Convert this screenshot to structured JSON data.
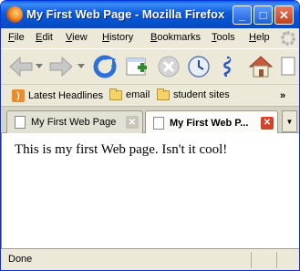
{
  "window": {
    "title": "My First Web Page - Mozilla Firefox",
    "minimize_glyph": "_",
    "maximize_glyph": "□",
    "close_glyph": "✕"
  },
  "menu": {
    "items": [
      {
        "first": "F",
        "rest": "ile"
      },
      {
        "first": "E",
        "rest": "dit"
      },
      {
        "first": "V",
        "rest": "iew"
      },
      {
        "first": "H",
        "rest": "istory"
      },
      {
        "first": "B",
        "rest": "ookmarks"
      },
      {
        "first": "T",
        "rest": "ools"
      },
      {
        "first": "H",
        "rest": "elp"
      }
    ]
  },
  "navbar": {
    "icons": [
      "back-icon",
      "back-dropdown-icon",
      "forward-icon",
      "forward-dropdown-icon",
      "reload-icon",
      "new-tab-icon",
      "stop-icon",
      "history-clock-icon",
      "addon-seahorse-icon",
      "home-icon"
    ],
    "accent": "#2f8a2f"
  },
  "bookmarks": {
    "items": [
      {
        "label": "Latest Headlines",
        "icon": "rss-icon"
      },
      {
        "label": "email",
        "icon": "folder-icon"
      },
      {
        "label": "student sites",
        "icon": "folder-icon"
      }
    ],
    "overflow_glyph": "»"
  },
  "tabs": {
    "items": [
      {
        "label": "My First Web Page",
        "active": false,
        "close_glyph": "✕"
      },
      {
        "label": "My First Web P...",
        "active": true,
        "close_glyph": "✕"
      }
    ],
    "list_glyph": "▼"
  },
  "content": {
    "text": "This is my first Web page. Isn't it cool!"
  },
  "status": {
    "text": "Done"
  },
  "colors": {
    "titlebar": "#0550d1",
    "chrome": "#ece9d8",
    "close_button": "#d6412c"
  }
}
